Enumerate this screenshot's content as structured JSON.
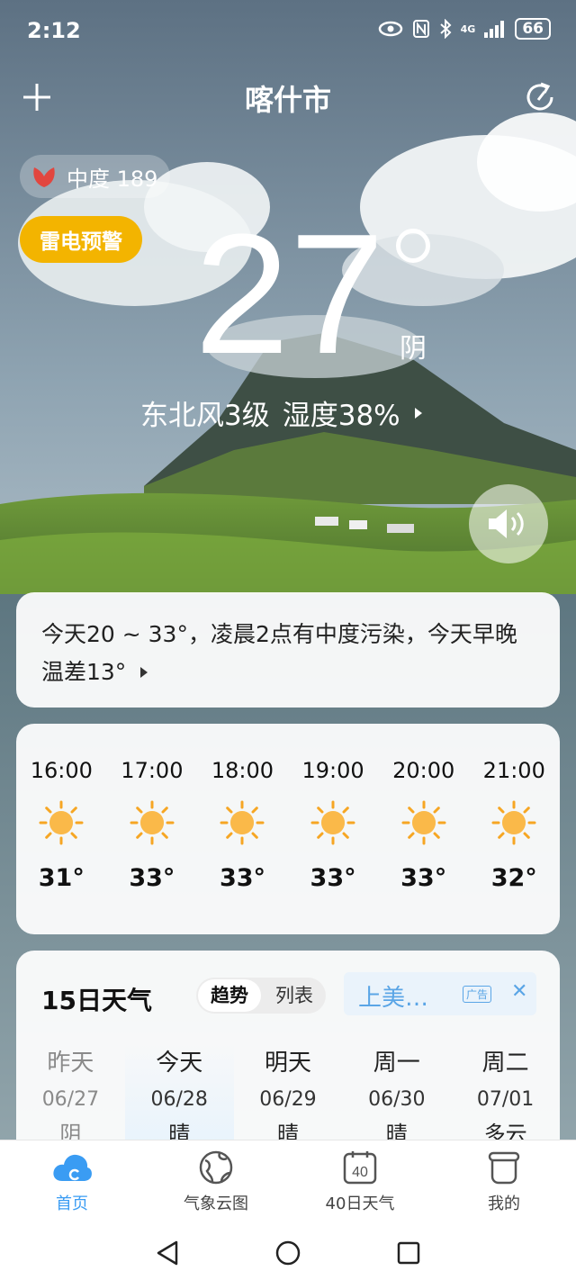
{
  "status_bar": {
    "time": "2:12",
    "battery": "66",
    "signal": "4G"
  },
  "header": {
    "city": "喀什市"
  },
  "air_quality": {
    "label": "中度 189"
  },
  "warning": {
    "label": "雷电预警"
  },
  "current": {
    "temperature": "27",
    "condition": "阴",
    "wind": "东北风3级",
    "humidity": "湿度38%"
  },
  "summary": {
    "text": "今天20 ~ 33°，凌晨2点有中度污染，今天早晚温差13°"
  },
  "hourly": [
    {
      "time": "16:00",
      "temp": "31°",
      "icon": "sun-icon"
    },
    {
      "time": "17:00",
      "temp": "33°",
      "icon": "sun-icon"
    },
    {
      "time": "18:00",
      "temp": "33°",
      "icon": "sun-icon"
    },
    {
      "time": "19:00",
      "temp": "33°",
      "icon": "sun-icon"
    },
    {
      "time": "20:00",
      "temp": "33°",
      "icon": "sun-icon"
    },
    {
      "time": "21:00",
      "temp": "32°",
      "icon": "sun-icon"
    }
  ],
  "forecast": {
    "title": "15日天气",
    "tabs": [
      "趋势",
      "列表"
    ],
    "active_tab": "趋势",
    "ad_text": "上美…",
    "ad_tag": "广告",
    "days": [
      {
        "name": "昨天",
        "date": "06/27",
        "weather": "阴"
      },
      {
        "name": "今天",
        "date": "06/28",
        "weather": "晴"
      },
      {
        "name": "明天",
        "date": "06/29",
        "weather": "晴"
      },
      {
        "name": "周一",
        "date": "06/30",
        "weather": "晴"
      },
      {
        "name": "周二",
        "date": "07/01",
        "weather": "多云"
      }
    ]
  },
  "tab_bar": [
    {
      "label": "首页",
      "icon": "cloud-icon",
      "active": true
    },
    {
      "label": "气象云图",
      "icon": "globe-icon",
      "active": false
    },
    {
      "label": "40日天气",
      "icon": "calendar-40-icon",
      "active": false
    },
    {
      "label": "我的",
      "icon": "cup-icon",
      "active": false
    }
  ],
  "calendar_badge": "40",
  "colors": {
    "accent": "#3a9cf3",
    "warning": "#f3b400",
    "sun": "#f6a623"
  }
}
